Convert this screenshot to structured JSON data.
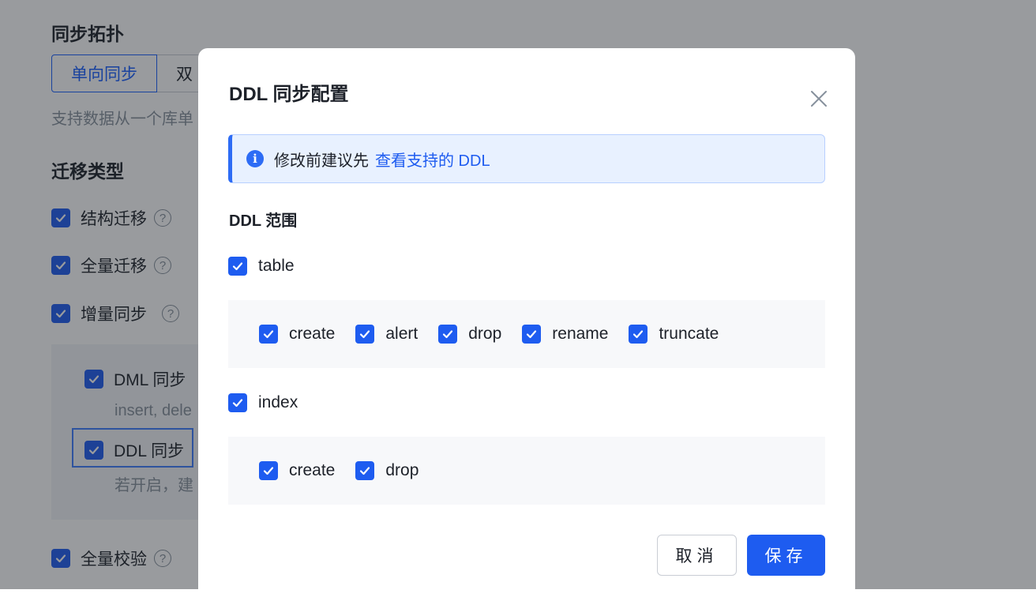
{
  "background": {
    "topology_title": "同步拓扑",
    "topology_options": [
      "单向同步",
      "双"
    ],
    "topology_desc": "支持数据从一个库单",
    "migration_title": "迁移类型",
    "items": [
      {
        "label": "结构迁移",
        "has_help": true
      },
      {
        "label": "全量迁移",
        "has_help": true
      },
      {
        "label": "增量同步",
        "has_help": true
      }
    ],
    "sub_items": [
      {
        "label": "DML 同步",
        "desc": "insert, dele"
      },
      {
        "label": "DDL 同步",
        "desc": "若开启，建"
      }
    ],
    "verify_label": "全量校验",
    "help_glyph": "?"
  },
  "modal": {
    "title": "DDL 同步配置",
    "close_icon": "close-icon",
    "alert": {
      "icon_glyph": "i",
      "text": "修改前建议先",
      "link": "查看支持的 DDL"
    },
    "scope_label": "DDL 范围",
    "groups": [
      {
        "label": "table",
        "checked": true,
        "options": [
          "create",
          "alert",
          "drop",
          "rename",
          "truncate"
        ]
      },
      {
        "label": "index",
        "checked": true,
        "options": [
          "create",
          "drop"
        ]
      }
    ],
    "cancel_label": "取消",
    "save_label": "保存"
  },
  "colors": {
    "primary": "#1e5cf0",
    "alert_bg": "#e8f1ff",
    "overlay": "rgba(29,33,41,0.45)"
  }
}
